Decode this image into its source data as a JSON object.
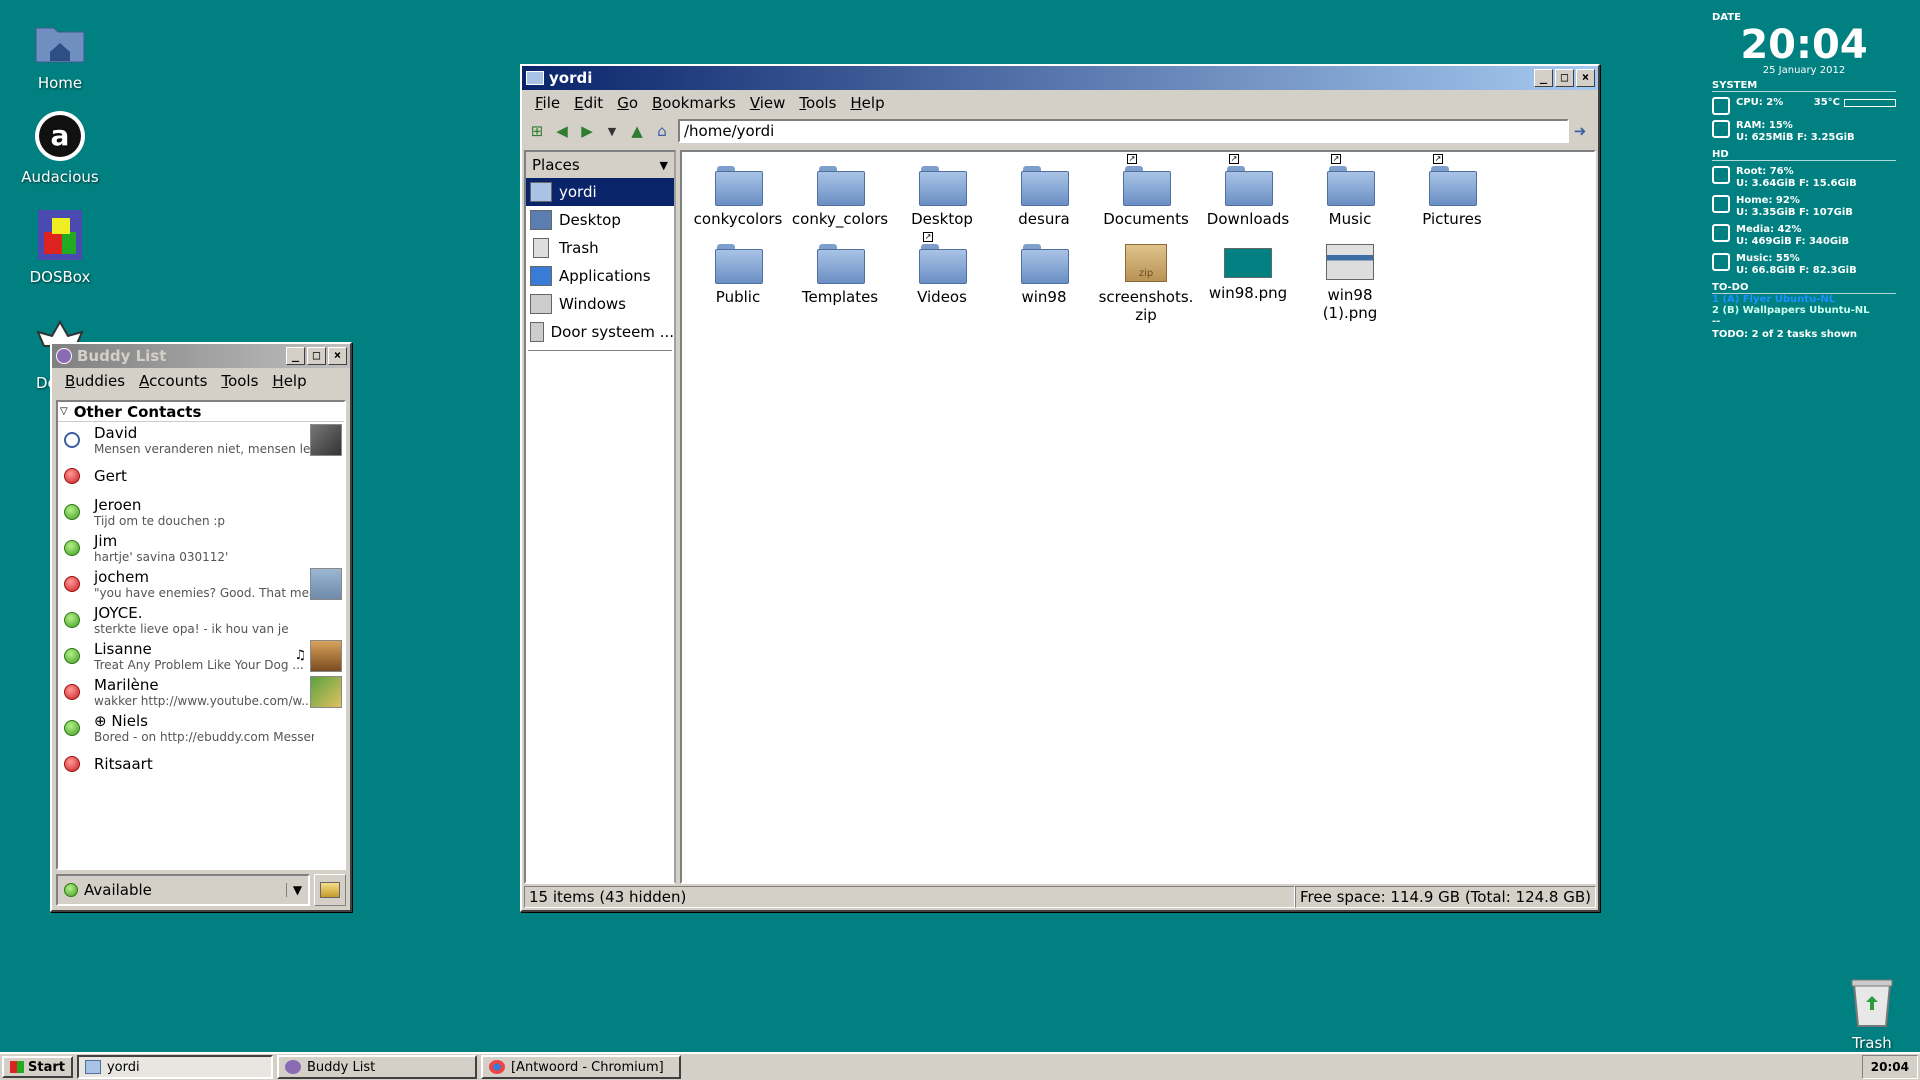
{
  "desktop": {
    "icons": [
      {
        "label": "Home"
      },
      {
        "label": "Audacious"
      },
      {
        "label": "DOSBox"
      },
      {
        "label": "De"
      },
      {
        "label": "Trash"
      }
    ]
  },
  "file_manager": {
    "title": "yordi",
    "menu": [
      "File",
      "Edit",
      "Go",
      "Bookmarks",
      "View",
      "Tools",
      "Help"
    ],
    "address": "/home/yordi",
    "places_label": "Places",
    "places": [
      {
        "label": "yordi",
        "selected": true
      },
      {
        "label": "Desktop"
      },
      {
        "label": "Trash"
      },
      {
        "label": "Applications"
      },
      {
        "label": "Windows"
      },
      {
        "label": "Door systeem ..."
      }
    ],
    "files": [
      {
        "name": "conkycolors"
      },
      {
        "name": "conky_colors"
      },
      {
        "name": "Desktop"
      },
      {
        "name": "desura"
      },
      {
        "name": "Documents"
      },
      {
        "name": "Downloads"
      },
      {
        "name": "Music"
      },
      {
        "name": "Pictures"
      },
      {
        "name": "Public"
      },
      {
        "name": "Templates"
      },
      {
        "name": "Videos"
      },
      {
        "name": "win98"
      },
      {
        "name": "screenshots.\nzip"
      },
      {
        "name": "win98.png"
      },
      {
        "name": "win98 (1).png"
      }
    ],
    "status_left": "15 items (43 hidden)",
    "status_right": "Free space: 114.9 GB (Total: 124.8 GB)"
  },
  "buddy_list": {
    "title": "Buddy List",
    "menu": [
      "Buddies",
      "Accounts",
      "Tools",
      "Help"
    ],
    "group": "Other Contacts",
    "buddies": [
      {
        "name": "David",
        "message": "Mensen veranderen niet, mensen lere...",
        "status": "idle"
      },
      {
        "name": "Gert",
        "message": "",
        "status": "busy"
      },
      {
        "name": "Jeroen",
        "message": "Tijd om te douchen :p",
        "status": "ok"
      },
      {
        "name": "Jim",
        "message": "hartje' savina 030112'",
        "status": "ok"
      },
      {
        "name": "jochem",
        "message": "\"you have enemies? Good. That means...",
        "status": "busy"
      },
      {
        "name": "JOYCE.",
        "message": "sterkte lieve opa! - ik hou van je",
        "status": "ok"
      },
      {
        "name": "Lisanne",
        "message": "Treat Any Problem Like Your Dog ...",
        "status": "ok"
      },
      {
        "name": "Marilène",
        "message": "wakker   http://www.youtube.com/w...",
        "status": "busy"
      },
      {
        "name": "⊕ Niels",
        "message": "Bored - on http://ebuddy.com Messen...",
        "status": "ok"
      },
      {
        "name": "Ritsaart",
        "message": "",
        "status": "busy"
      }
    ],
    "status_value": "Available"
  },
  "conky": {
    "date_label": "DATE",
    "time": "20:04",
    "date": "25 January 2012",
    "system_label": "SYSTEM",
    "cpu": "CPU: 2%",
    "temp": "35°C",
    "ram": "RAM: 15%",
    "ram_detail": "U: 625MiB F: 3.25GiB",
    "hd_label": "HD",
    "disks": [
      {
        "name": "Root: 76%",
        "detail": "U: 3.64GiB F: 15.6GiB"
      },
      {
        "name": "Home: 92%",
        "detail": "U: 3.35GiB F: 107GiB"
      },
      {
        "name": "Media: 42%",
        "detail": "U: 469GiB F: 340GiB"
      },
      {
        "name": "Music: 55%",
        "detail": "U: 66.8GiB F: 82.3GiB"
      }
    ],
    "todo_label": "TO-DO",
    "todo_items": [
      "1 (A) Flyer Ubuntu-NL",
      "2 (B) Wallpapers Ubuntu-NL",
      "--"
    ],
    "todo_summary": "TODO: 2 of 2 tasks shown"
  },
  "taskbar": {
    "start": "Start",
    "tasks": [
      {
        "label": "yordi",
        "active": true
      },
      {
        "label": "Buddy List"
      },
      {
        "label": "[Antwoord - Chromium]"
      }
    ],
    "clock": "20:04"
  }
}
